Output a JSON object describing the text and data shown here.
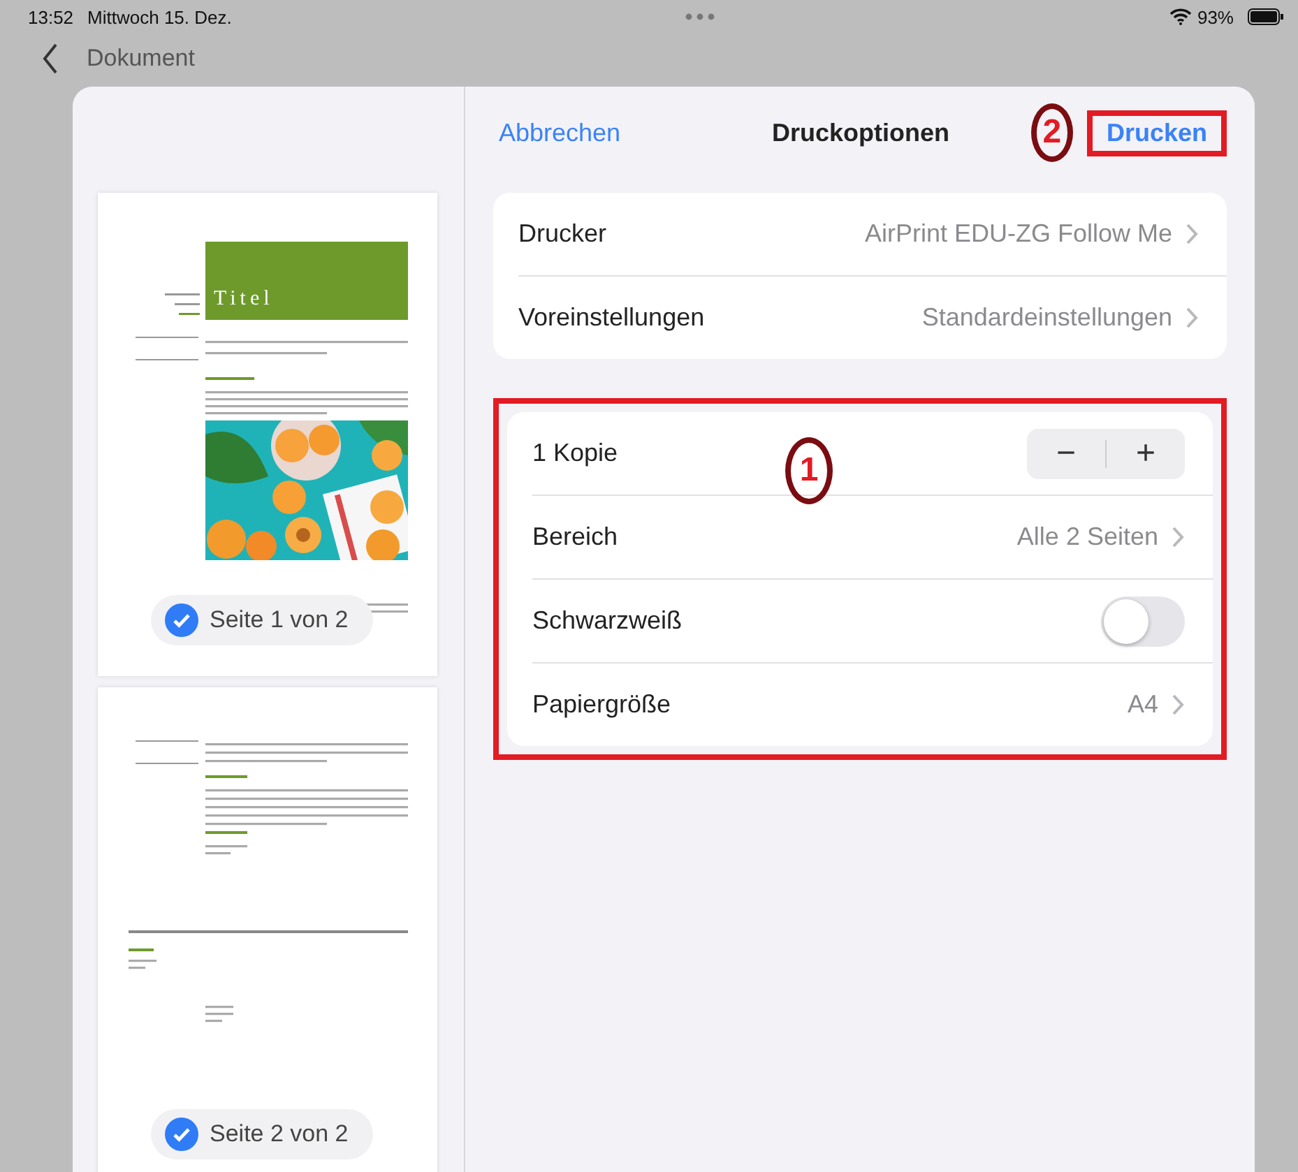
{
  "status_bar": {
    "time": "13:52",
    "date": "Mittwoch 15. Dez.",
    "battery": "93%"
  },
  "nav_bar": {
    "title": "Dokument"
  },
  "sheet": {
    "cancel": "Abbrechen",
    "title": "Druckoptionen",
    "print": "Drucken",
    "pages": [
      {
        "kind": "cover",
        "heading": "Titel",
        "label": "Seite 1 von 2",
        "selected": true
      },
      {
        "kind": "text",
        "label": "Seite 2 von 2",
        "selected": true
      }
    ],
    "printer_group": [
      {
        "label": "Drucker",
        "value": "AirPrint EDU-ZG Follow Me"
      },
      {
        "label": "Voreinstellungen",
        "value": "Standardeinstellungen"
      }
    ],
    "options_group": [
      {
        "kind": "stepper",
        "label": "1 Kopie",
        "minus": "−",
        "plus": "+"
      },
      {
        "kind": "link",
        "label": "Bereich",
        "value": "Alle 2 Seiten"
      },
      {
        "kind": "toggle",
        "label": "Schwarzweiß",
        "on": false
      },
      {
        "kind": "link",
        "label": "Papiergröße",
        "value": "A4"
      }
    ]
  },
  "annotations": [
    {
      "label": "2"
    },
    {
      "label": "1"
    }
  ]
}
